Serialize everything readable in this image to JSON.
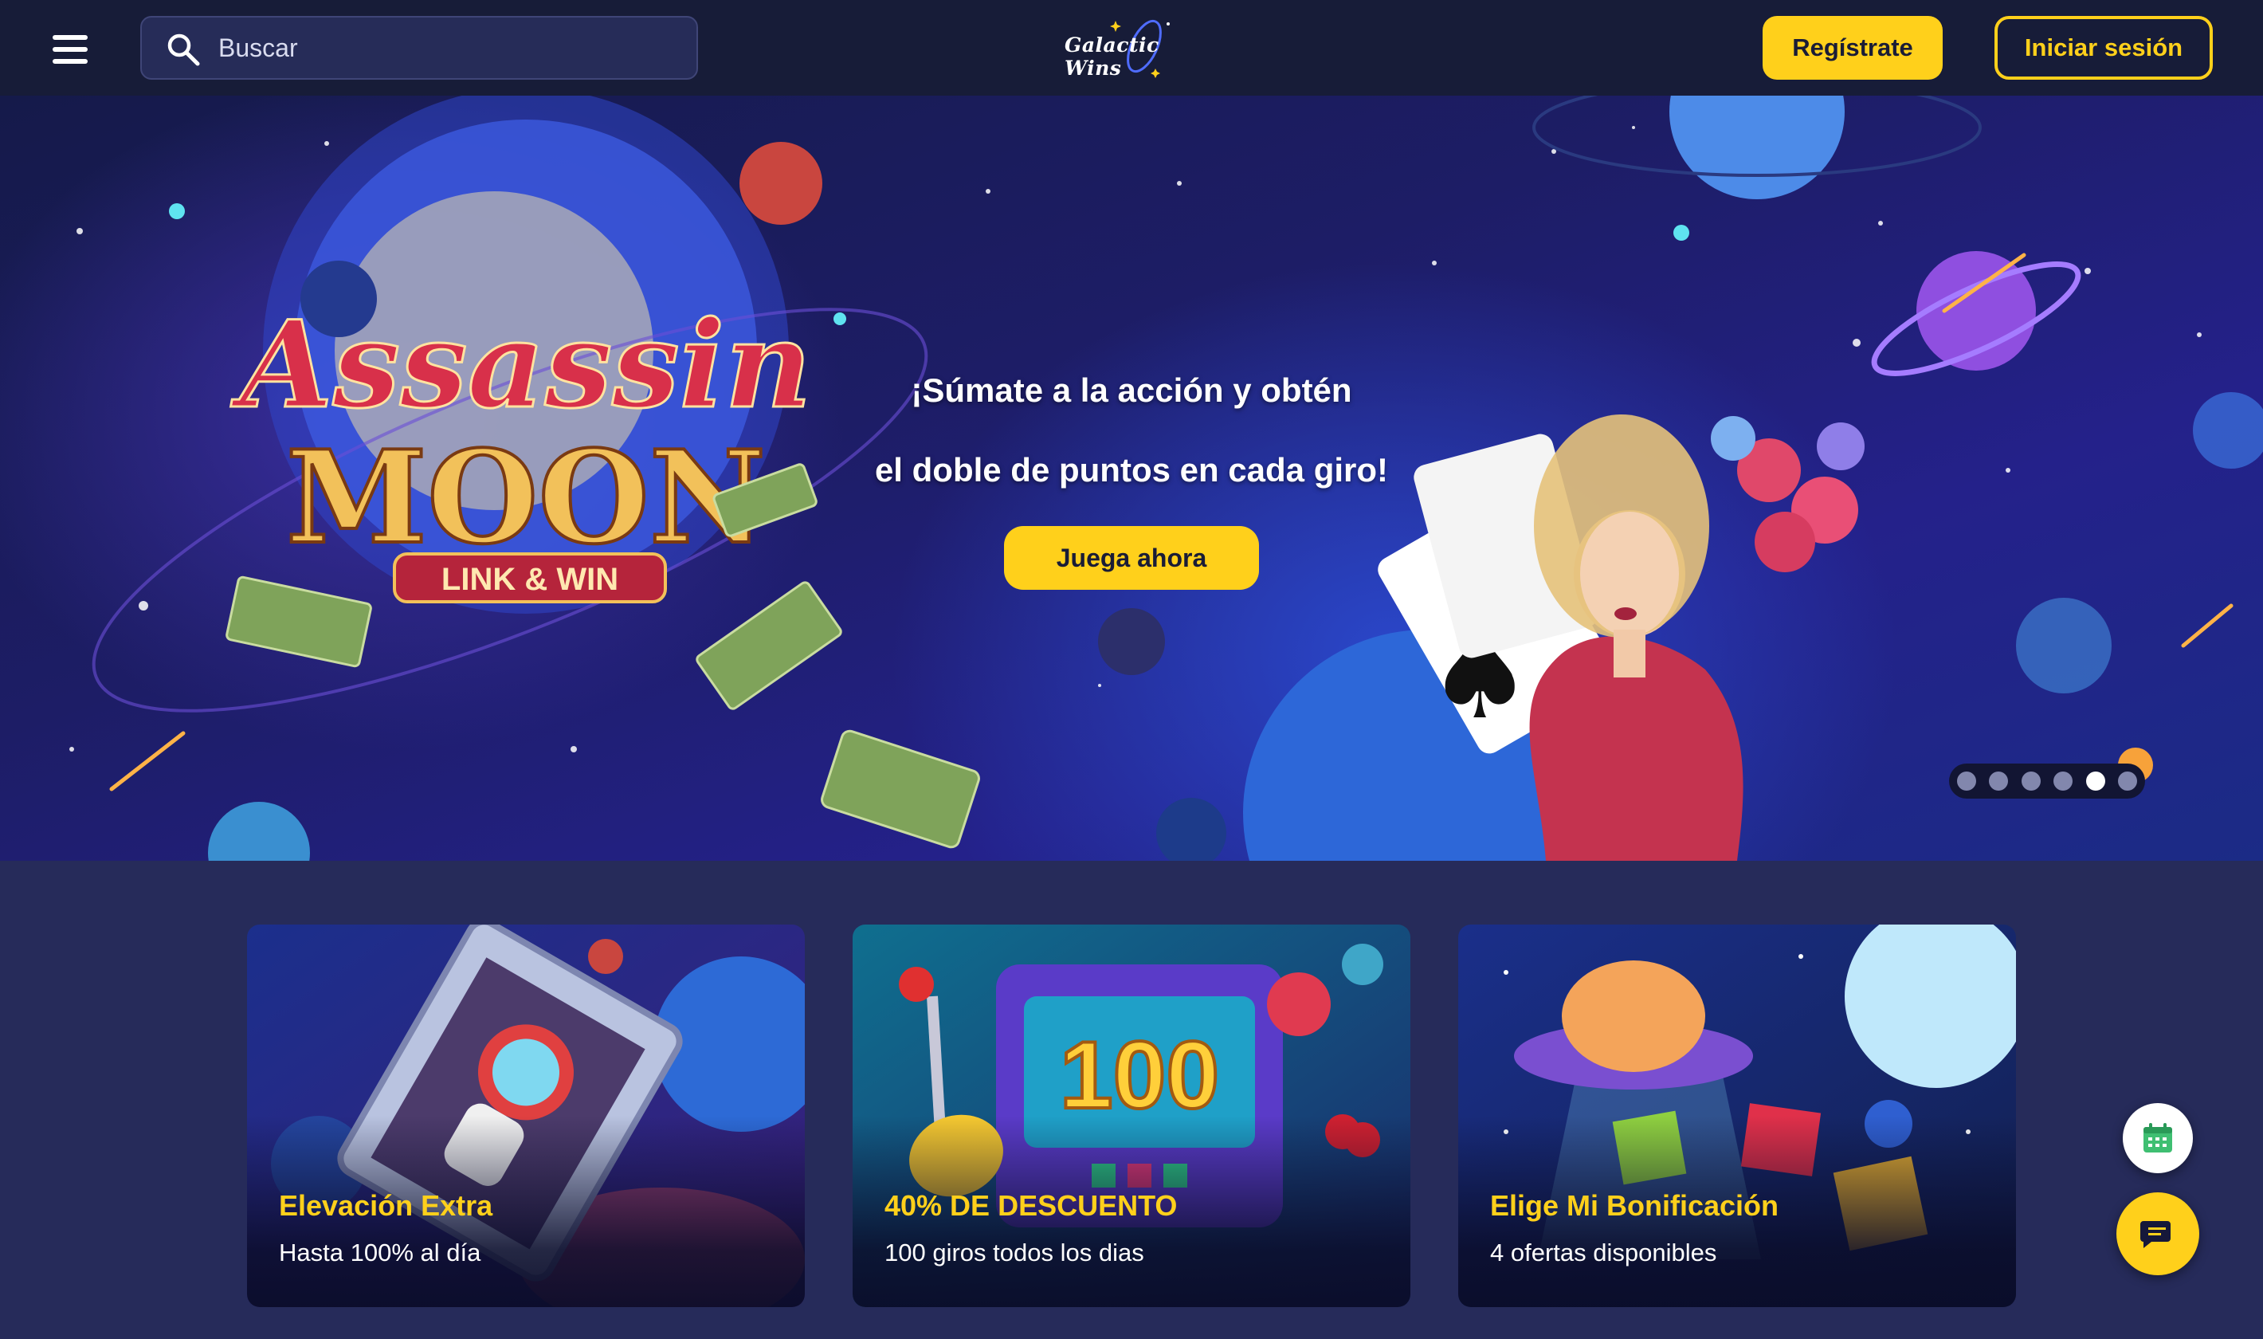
{
  "header": {
    "search_placeholder": "Buscar",
    "logo_text": "Galactic Wins",
    "register_label": "Regístrate",
    "login_label": "Iniciar sesión"
  },
  "hero": {
    "line1": "¡Súmate a la acción y obtén",
    "line2": "el doble de puntos en cada giro!",
    "cta_label": "Juega ahora",
    "game_logo_text": "Assassin Moon Link & Win",
    "slide_count": 6,
    "active_slide": 5
  },
  "promos": [
    {
      "title": "Elevación Extra",
      "subtitle": "Hasta 100% al día"
    },
    {
      "title": "40% DE DESCUENTO",
      "subtitle": "100 giros todos los dias"
    },
    {
      "title": "Elige Mi Bonificación",
      "subtitle": "4 ofertas disponibles"
    }
  ],
  "icons": [
    "menu-icon",
    "search-icon",
    "calendar-icon",
    "chat-icon"
  ],
  "colors": {
    "accent": "#ffd01b",
    "header_bg": "#171c38",
    "page_bg": "#262b5a"
  }
}
